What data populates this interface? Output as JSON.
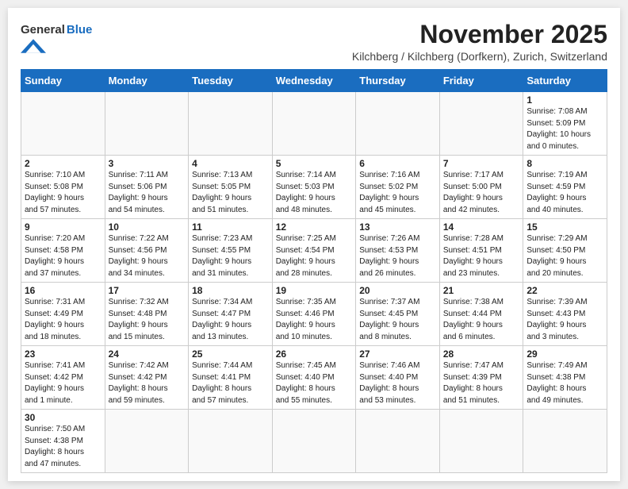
{
  "header": {
    "logo_general": "General",
    "logo_blue": "Blue",
    "month_year": "November 2025",
    "location": "Kilchberg / Kilchberg (Dorfkern), Zurich, Switzerland"
  },
  "days_of_week": [
    "Sunday",
    "Monday",
    "Tuesday",
    "Wednesday",
    "Thursday",
    "Friday",
    "Saturday"
  ],
  "weeks": [
    [
      {
        "day": "",
        "info": ""
      },
      {
        "day": "",
        "info": ""
      },
      {
        "day": "",
        "info": ""
      },
      {
        "day": "",
        "info": ""
      },
      {
        "day": "",
        "info": ""
      },
      {
        "day": "",
        "info": ""
      },
      {
        "day": "1",
        "info": "Sunrise: 7:08 AM\nSunset: 5:09 PM\nDaylight: 10 hours\nand 0 minutes."
      }
    ],
    [
      {
        "day": "2",
        "info": "Sunrise: 7:10 AM\nSunset: 5:08 PM\nDaylight: 9 hours\nand 57 minutes."
      },
      {
        "day": "3",
        "info": "Sunrise: 7:11 AM\nSunset: 5:06 PM\nDaylight: 9 hours\nand 54 minutes."
      },
      {
        "day": "4",
        "info": "Sunrise: 7:13 AM\nSunset: 5:05 PM\nDaylight: 9 hours\nand 51 minutes."
      },
      {
        "day": "5",
        "info": "Sunrise: 7:14 AM\nSunset: 5:03 PM\nDaylight: 9 hours\nand 48 minutes."
      },
      {
        "day": "6",
        "info": "Sunrise: 7:16 AM\nSunset: 5:02 PM\nDaylight: 9 hours\nand 45 minutes."
      },
      {
        "day": "7",
        "info": "Sunrise: 7:17 AM\nSunset: 5:00 PM\nDaylight: 9 hours\nand 42 minutes."
      },
      {
        "day": "8",
        "info": "Sunrise: 7:19 AM\nSunset: 4:59 PM\nDaylight: 9 hours\nand 40 minutes."
      }
    ],
    [
      {
        "day": "9",
        "info": "Sunrise: 7:20 AM\nSunset: 4:58 PM\nDaylight: 9 hours\nand 37 minutes."
      },
      {
        "day": "10",
        "info": "Sunrise: 7:22 AM\nSunset: 4:56 PM\nDaylight: 9 hours\nand 34 minutes."
      },
      {
        "day": "11",
        "info": "Sunrise: 7:23 AM\nSunset: 4:55 PM\nDaylight: 9 hours\nand 31 minutes."
      },
      {
        "day": "12",
        "info": "Sunrise: 7:25 AM\nSunset: 4:54 PM\nDaylight: 9 hours\nand 28 minutes."
      },
      {
        "day": "13",
        "info": "Sunrise: 7:26 AM\nSunset: 4:53 PM\nDaylight: 9 hours\nand 26 minutes."
      },
      {
        "day": "14",
        "info": "Sunrise: 7:28 AM\nSunset: 4:51 PM\nDaylight: 9 hours\nand 23 minutes."
      },
      {
        "day": "15",
        "info": "Sunrise: 7:29 AM\nSunset: 4:50 PM\nDaylight: 9 hours\nand 20 minutes."
      }
    ],
    [
      {
        "day": "16",
        "info": "Sunrise: 7:31 AM\nSunset: 4:49 PM\nDaylight: 9 hours\nand 18 minutes."
      },
      {
        "day": "17",
        "info": "Sunrise: 7:32 AM\nSunset: 4:48 PM\nDaylight: 9 hours\nand 15 minutes."
      },
      {
        "day": "18",
        "info": "Sunrise: 7:34 AM\nSunset: 4:47 PM\nDaylight: 9 hours\nand 13 minutes."
      },
      {
        "day": "19",
        "info": "Sunrise: 7:35 AM\nSunset: 4:46 PM\nDaylight: 9 hours\nand 10 minutes."
      },
      {
        "day": "20",
        "info": "Sunrise: 7:37 AM\nSunset: 4:45 PM\nDaylight: 9 hours\nand 8 minutes."
      },
      {
        "day": "21",
        "info": "Sunrise: 7:38 AM\nSunset: 4:44 PM\nDaylight: 9 hours\nand 6 minutes."
      },
      {
        "day": "22",
        "info": "Sunrise: 7:39 AM\nSunset: 4:43 PM\nDaylight: 9 hours\nand 3 minutes."
      }
    ],
    [
      {
        "day": "23",
        "info": "Sunrise: 7:41 AM\nSunset: 4:42 PM\nDaylight: 9 hours\nand 1 minute."
      },
      {
        "day": "24",
        "info": "Sunrise: 7:42 AM\nSunset: 4:42 PM\nDaylight: 8 hours\nand 59 minutes."
      },
      {
        "day": "25",
        "info": "Sunrise: 7:44 AM\nSunset: 4:41 PM\nDaylight: 8 hours\nand 57 minutes."
      },
      {
        "day": "26",
        "info": "Sunrise: 7:45 AM\nSunset: 4:40 PM\nDaylight: 8 hours\nand 55 minutes."
      },
      {
        "day": "27",
        "info": "Sunrise: 7:46 AM\nSunset: 4:40 PM\nDaylight: 8 hours\nand 53 minutes."
      },
      {
        "day": "28",
        "info": "Sunrise: 7:47 AM\nSunset: 4:39 PM\nDaylight: 8 hours\nand 51 minutes."
      },
      {
        "day": "29",
        "info": "Sunrise: 7:49 AM\nSunset: 4:38 PM\nDaylight: 8 hours\nand 49 minutes."
      }
    ],
    [
      {
        "day": "30",
        "info": "Sunrise: 7:50 AM\nSunset: 4:38 PM\nDaylight: 8 hours\nand 47 minutes."
      },
      {
        "day": "",
        "info": ""
      },
      {
        "day": "",
        "info": ""
      },
      {
        "day": "",
        "info": ""
      },
      {
        "day": "",
        "info": ""
      },
      {
        "day": "",
        "info": ""
      },
      {
        "day": "",
        "info": ""
      }
    ]
  ]
}
